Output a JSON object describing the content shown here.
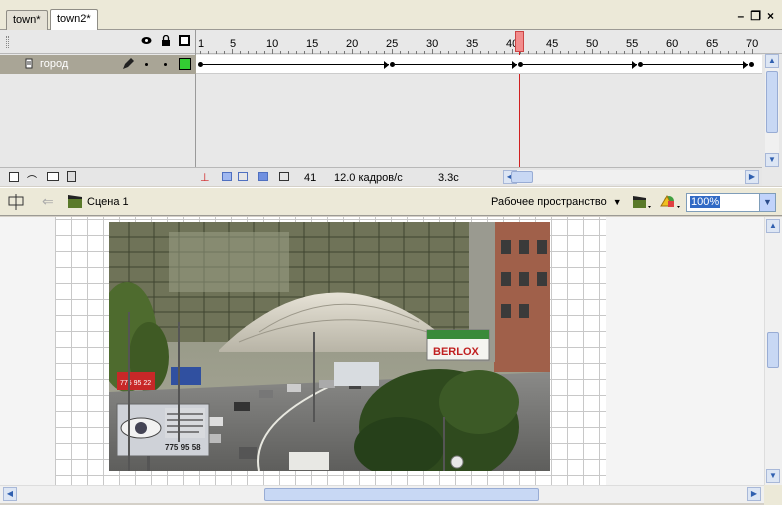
{
  "tabs": [
    {
      "label": "town*"
    },
    {
      "label": "town2*"
    }
  ],
  "window_controls": {
    "minimize": "–",
    "restore": "❐",
    "close": "×"
  },
  "timeline": {
    "ruler_ticks": [
      "1",
      "5",
      "10",
      "15",
      "20",
      "25",
      "30",
      "35",
      "40",
      "45",
      "50",
      "55",
      "60",
      "65",
      "70"
    ],
    "current_frame_marker": 41,
    "layer": {
      "name": "город",
      "color": "#33cc33"
    },
    "status": {
      "current_frame": "41",
      "frame_rate": "12.0 кадров/с",
      "elapsed_time": "3.3с"
    }
  },
  "editbar": {
    "scene_label": "Сцена 1",
    "workspace_label": "Рабочее пространство",
    "zoom": "100%"
  },
  "stage": {
    "photo_signs": {
      "sign_berlo": "BERLOX",
      "sign_phone": "775 95 58",
      "sign_red": "775 95 22"
    }
  },
  "colors": {
    "accent": "#316ac5",
    "layer_row": "#a9a596",
    "playhead": "#f28c8c"
  }
}
